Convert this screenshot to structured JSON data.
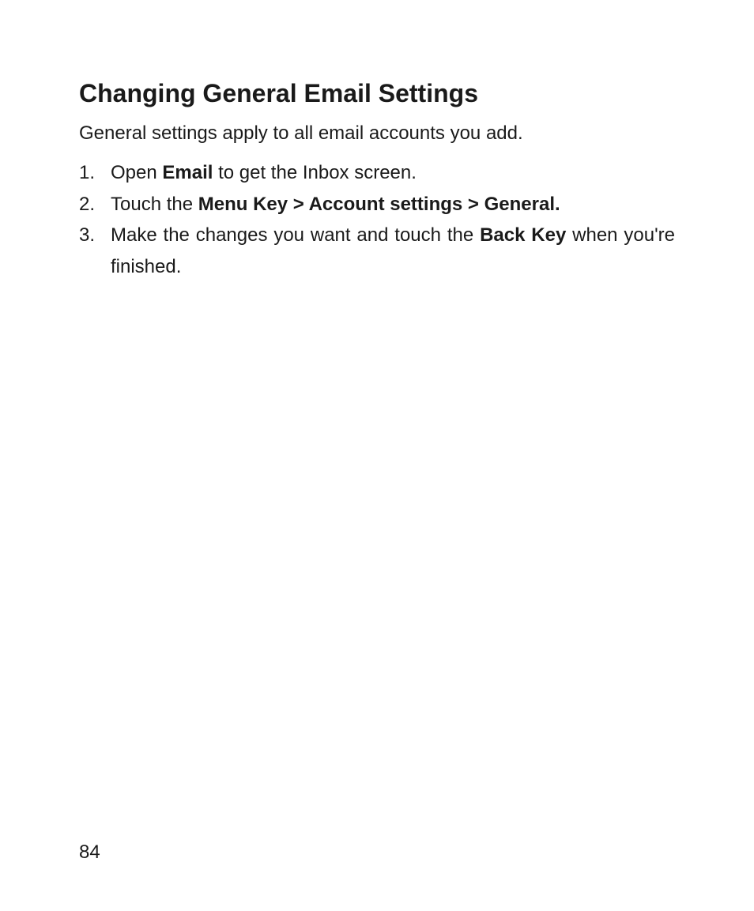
{
  "heading": "Changing General Email Settings",
  "intro": "General settings apply to all email accounts you add.",
  "steps": [
    {
      "number": "1.",
      "parts": [
        {
          "text": "Open ",
          "bold": false
        },
        {
          "text": "Email",
          "bold": true
        },
        {
          "text": " to get the Inbox screen.",
          "bold": false
        }
      ]
    },
    {
      "number": "2.",
      "parts": [
        {
          "text": "Touch the ",
          "bold": false
        },
        {
          "text": "Menu Key > Account settings > General.",
          "bold": true
        }
      ]
    },
    {
      "number": "3.",
      "parts": [
        {
          "text": "Make the changes you want and touch the ",
          "bold": false
        },
        {
          "text": "Back Key",
          "bold": true
        },
        {
          "text": " when you're finished.",
          "bold": false
        }
      ]
    }
  ],
  "pageNumber": "84"
}
